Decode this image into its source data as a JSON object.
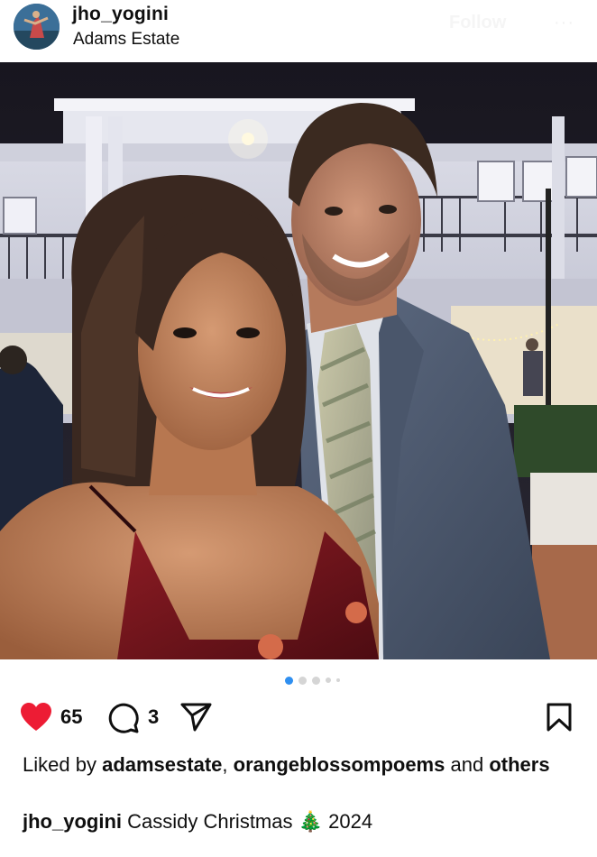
{
  "post": {
    "username": "jho_yogini",
    "location": "Adams Estate",
    "follow_label": "Follow",
    "more_label": "···"
  },
  "carousel": {
    "total_dots": 5,
    "active_index": 0
  },
  "actions": {
    "like_count": "65",
    "comment_count": "3",
    "liked": true,
    "heart_color": "#ed1c34",
    "icons": [
      "heart-icon",
      "comment-icon",
      "share-icon",
      "bookmark-icon"
    ]
  },
  "likes": {
    "prefix": "Liked by",
    "user1": "adamsestate",
    "separator": ",",
    "user2": "orangeblossompoems",
    "conj": "and",
    "others": "others"
  },
  "caption": {
    "username": "jho_yogini",
    "text": "Cassidy Christmas",
    "emoji": "🎄",
    "year": "2024"
  },
  "colors": {
    "accent": "#2f8ff0",
    "text": "#0f0f0f"
  }
}
